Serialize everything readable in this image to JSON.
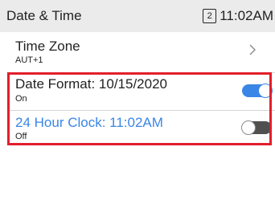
{
  "statusbar": {
    "title": "Date & Time",
    "sim_badge": "2",
    "time": "11:02AM"
  },
  "settings": {
    "time_zone": {
      "label": "Time Zone",
      "value": "AUT+1"
    },
    "date_format": {
      "label": "Date Format: 10/15/2020",
      "state": "On",
      "enabled": true
    },
    "clock_24h": {
      "label": "24 Hour Clock: 11:02AM",
      "state": "Off",
      "enabled": false
    }
  },
  "colors": {
    "accent": "#3a86e6",
    "highlight": "#e21e2b",
    "statusbar_bg": "#ebebeb"
  }
}
